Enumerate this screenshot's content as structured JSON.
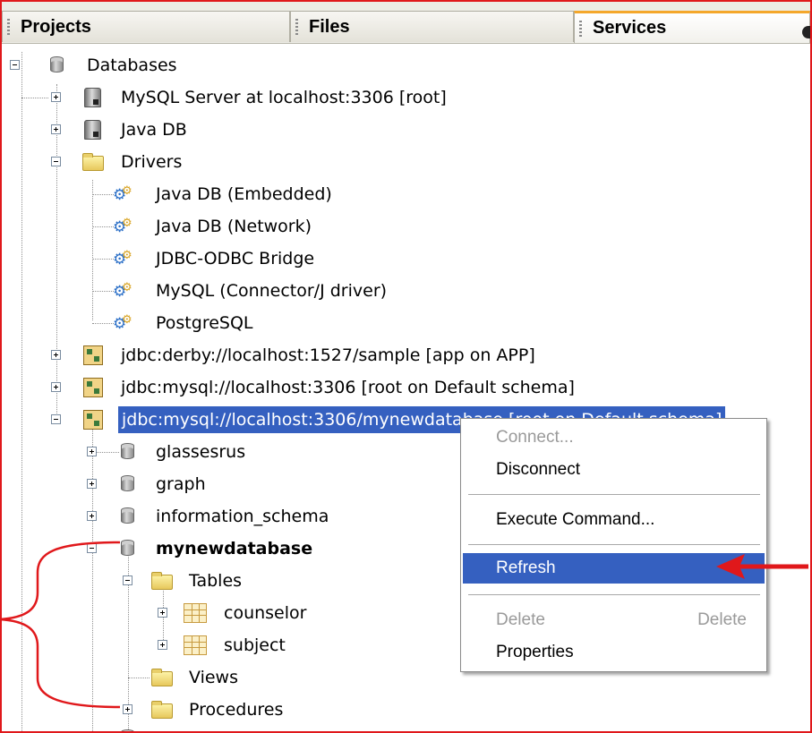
{
  "tabs": [
    {
      "label": "Projects",
      "active": false
    },
    {
      "label": "Files",
      "active": false
    },
    {
      "label": "Services",
      "active": true
    }
  ],
  "tree": {
    "databases": "Databases",
    "mysql_server": "MySQL Server at localhost:3306 [root]",
    "java_db": "Java DB",
    "drivers": "Drivers",
    "driver_items": [
      "Java DB (Embedded)",
      "Java DB (Network)",
      "JDBC-ODBC Bridge",
      "MySQL (Connector/J driver)",
      "PostgreSQL"
    ],
    "conn_derby": "jdbc:derby://localhost:1527/sample [app on APP]",
    "conn_mysql": "jdbc:mysql://localhost:3306 [root on Default schema]",
    "conn_mynewdb": "jdbc:mysql://localhost:3306/mynewdatabase [root on Default schema]",
    "schemas": [
      "glassesrus",
      "graph",
      "information_schema"
    ],
    "mynewdatabase": "mynewdatabase",
    "tables": "Tables",
    "table_items": [
      "counselor",
      "subject"
    ],
    "views": "Views",
    "procedures": "Procedures"
  },
  "context_menu": {
    "connect": "Connect...",
    "disconnect": "Disconnect",
    "execute_command": "Execute Command...",
    "refresh": "Refresh",
    "delete": "Delete",
    "delete_shortcut": "Delete",
    "properties": "Properties"
  },
  "colors": {
    "selection": "#3560c0",
    "annotation": "#e0181b",
    "active_tab_accent": "#f4a72b"
  }
}
